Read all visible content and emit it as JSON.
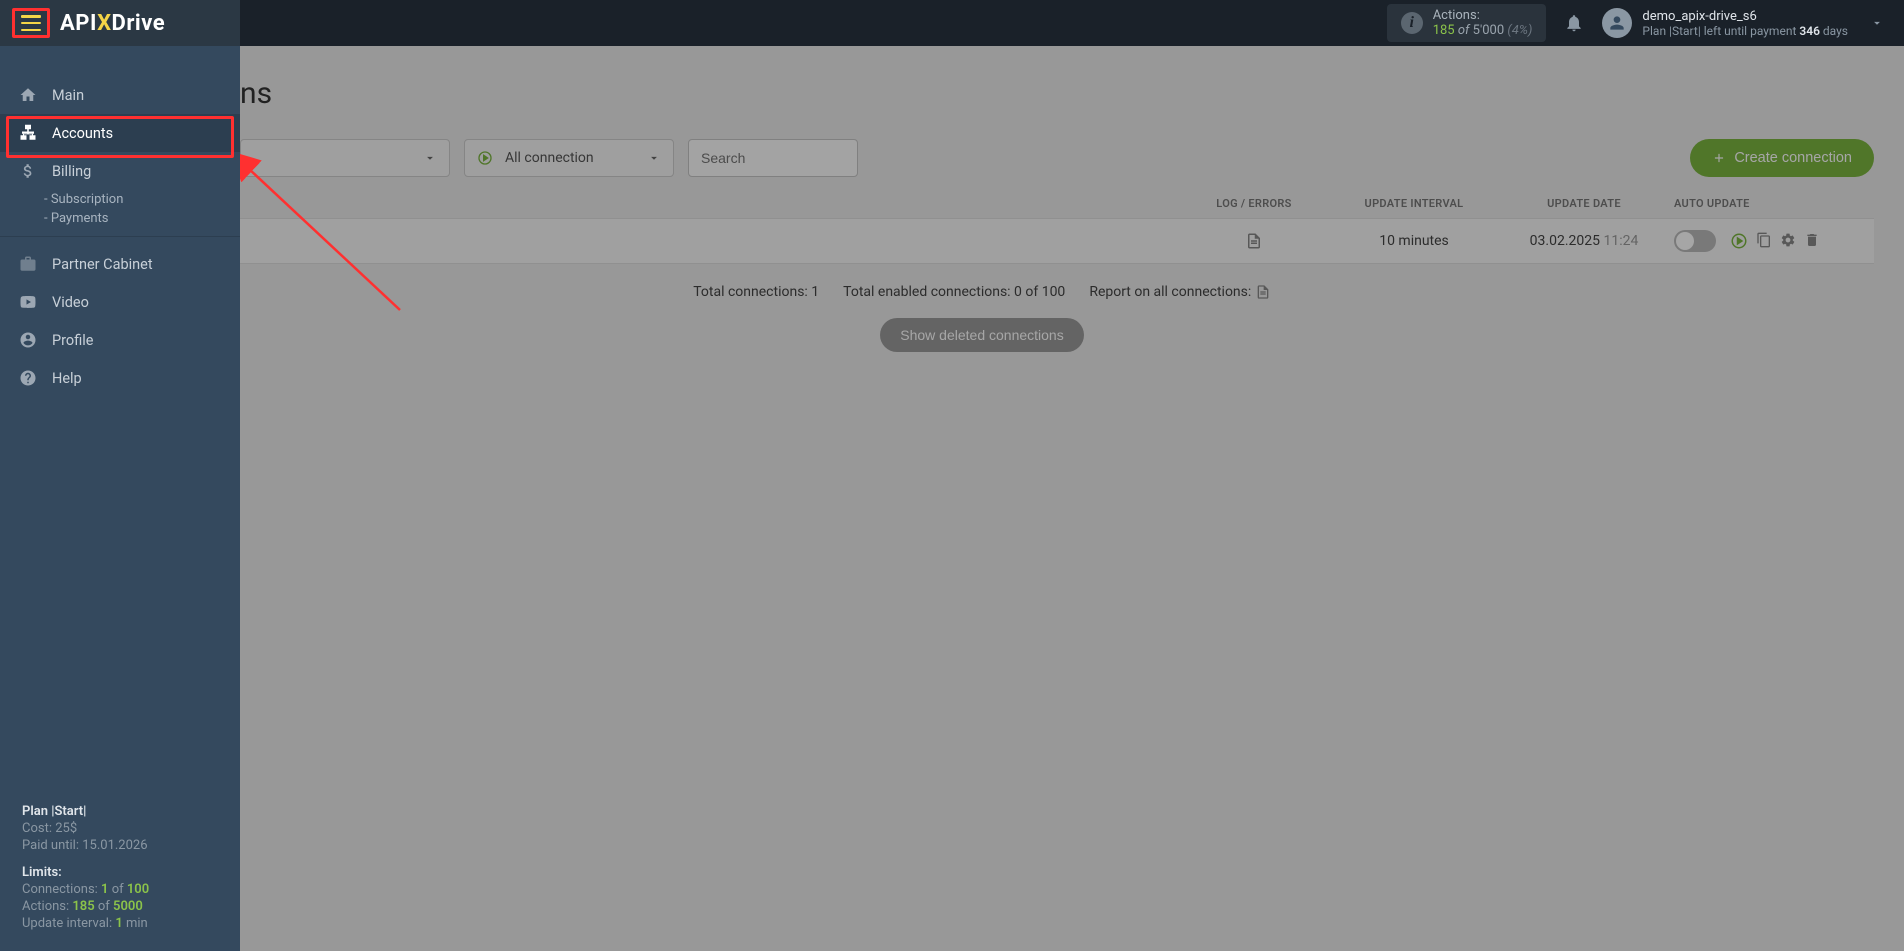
{
  "topbar": {
    "logo": {
      "api": "API",
      "x": "X",
      "drive": "Drive"
    },
    "actions": {
      "label": "Actions:",
      "used": "185",
      "of": "of",
      "total": "5'000",
      "pct": "(4%)"
    },
    "user": {
      "name": "demo_apix-drive_s6",
      "plan_prefix": "Plan |Start| left until payment ",
      "days": "346",
      "days_suffix": " days"
    }
  },
  "sidebar": {
    "items": [
      {
        "label": "Main",
        "icon": "home"
      },
      {
        "label": "Accounts",
        "icon": "sitemap",
        "active": true
      },
      {
        "label": "Billing",
        "icon": "dollar",
        "subs": [
          {
            "label": "- Subscription"
          },
          {
            "label": "- Payments"
          }
        ]
      },
      {
        "label": "Partner Cabinet",
        "icon": "briefcase"
      },
      {
        "label": "Video",
        "icon": "video"
      },
      {
        "label": "Profile",
        "icon": "user"
      },
      {
        "label": "Help",
        "icon": "help"
      }
    ],
    "footer": {
      "plan": "Plan |Start|",
      "cost_label": "Cost: ",
      "cost": "25$",
      "paid_label": "Paid until: ",
      "paid_until": "15.01.2026",
      "limits_header": "Limits:",
      "connections_label": "Connections: ",
      "connections_used": "1",
      "connections_of": " of ",
      "connections_total": "100",
      "actions_label": "Actions: ",
      "actions_used": "185",
      "actions_of": " of ",
      "actions_total": "5000",
      "interval_label": "Update interval: ",
      "interval_value": "1",
      "interval_suffix": " min"
    }
  },
  "main": {
    "title_suffix": "ns",
    "select1": "",
    "select2": "All connection",
    "search_placeholder": "Search",
    "create_btn": "Create connection",
    "headers": {
      "log": "LOG / ERRORS",
      "interval": "UPDATE INTERVAL",
      "date": "UPDATE DATE",
      "auto": "AUTO UPDATE"
    },
    "row": {
      "interval": "10 minutes",
      "date": "03.02.2025",
      "time": "11:24"
    },
    "summary": {
      "total": "Total connections: 1",
      "enabled": "Total enabled connections: 0 of 100",
      "report": "Report on all connections:"
    },
    "show_deleted": "Show deleted connections"
  }
}
